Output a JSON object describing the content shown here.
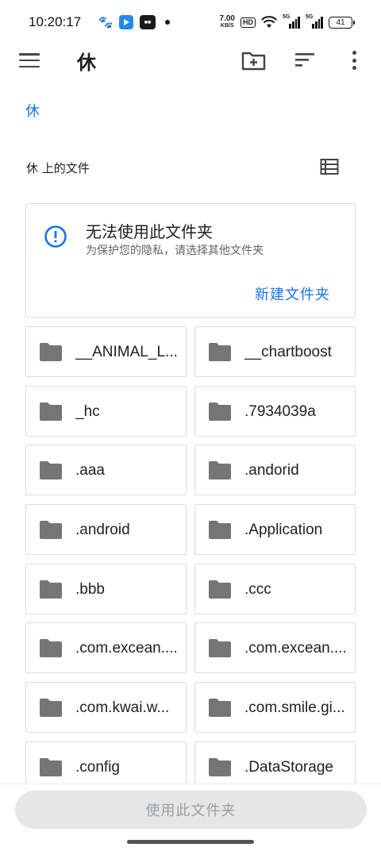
{
  "status_bar": {
    "time": "10:20:17",
    "net_speed_value": "7.00",
    "net_speed_unit": "KB/S",
    "hd_label": "HD",
    "signal1_label": "5G",
    "signal2_label": "5G",
    "battery": "41"
  },
  "app_bar": {
    "title": "休"
  },
  "breadcrumb": "休",
  "section_title": "休 上的文件",
  "warning": {
    "title": "无法使用此文件夹",
    "subtitle": "为保护您的隐私，请选择其他文件夹",
    "action": "新建文件夹"
  },
  "folders": [
    "__ANIMAL_L...",
    "__chartboost",
    "_hc",
    ".7934039a",
    ".aaa",
    ".andorid",
    ".android",
    ".Application",
    ".bbb",
    ".ccc",
    ".com.excean....",
    ".com.excean....",
    ".com.kwai.w...",
    ".com.smile.gi...",
    ".config",
    ".DataStorage"
  ],
  "bottom": {
    "use_button": "使用此文件夹"
  },
  "colors": {
    "accent": "#1a73e8",
    "folder_icon": "#757575",
    "border": "#dadce0"
  }
}
